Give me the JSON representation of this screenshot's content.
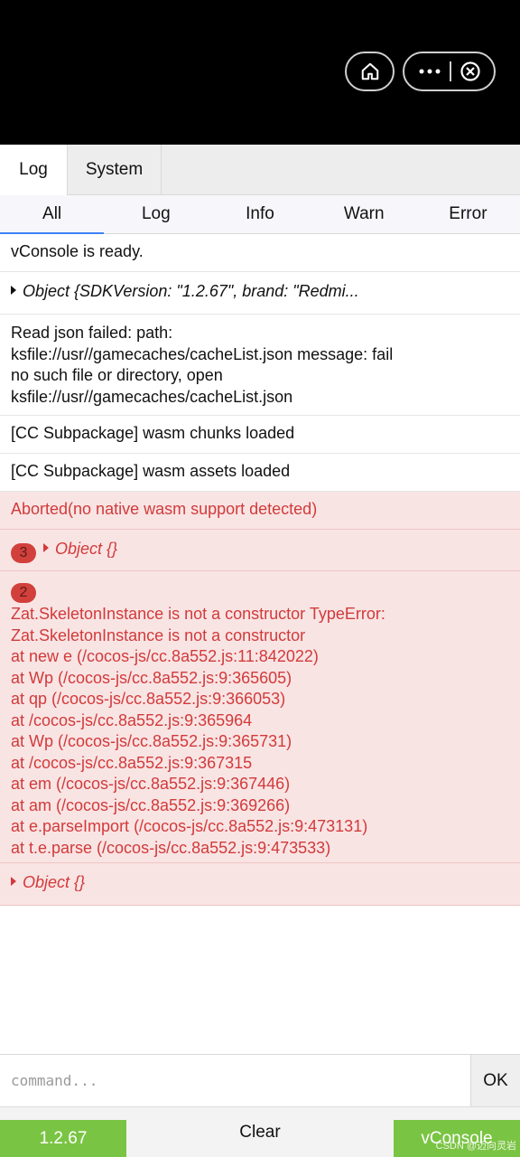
{
  "tabs": [
    "Log",
    "System"
  ],
  "filters": [
    "All",
    "Log",
    "Info",
    "Warn",
    "Error"
  ],
  "logs": {
    "ready": "vConsole is ready.",
    "object_sdk": "Object {SDKVersion: \"1.2.67\", brand: \"Redmi...",
    "read_json": [
      "Read json failed: path:",
      "ksfile://usr//gamecaches/cacheList.json message: fail",
      "no such file or directory, open",
      "ksfile://usr//gamecaches/cacheList.json"
    ],
    "wasm_chunks": "[CC Subpackage] wasm chunks loaded",
    "wasm_assets": "[CC Subpackage] wasm assets loaded",
    "aborted": "Aborted(no native wasm support detected)",
    "object_repeat_count": "3",
    "object_repeat": "Object {}",
    "error_repeat_count": "2",
    "error_lines": [
      "Zat.SkeletonInstance is not a constructor TypeError:",
      "Zat.SkeletonInstance is not a constructor",
      "at new e (/cocos-js/cc.8a552.js:11:842022)",
      "at Wp (/cocos-js/cc.8a552.js:9:365605)",
      "at qp (/cocos-js/cc.8a552.js:9:366053)",
      "at /cocos-js/cc.8a552.js:9:365964",
      "at Wp (/cocos-js/cc.8a552.js:9:365731)",
      "at /cocos-js/cc.8a552.js:9:367315",
      "at em (/cocos-js/cc.8a552.js:9:367446)",
      "at am (/cocos-js/cc.8a552.js:9:369266)",
      "at e.parseImport (/cocos-js/cc.8a552.js:9:473131)",
      "at t.e.parse (/cocos-js/cc.8a552.js:9:473533)"
    ],
    "object_last": "Object {}"
  },
  "command": {
    "placeholder": "command...",
    "ok_label": "OK"
  },
  "bottom": {
    "version": "1.2.67",
    "clear": "Clear",
    "vconsole": "vConsole"
  },
  "watermark": "CSDN @迈向灵岩",
  "colors": {
    "error_bg": "#f9e4e4",
    "error_text": "#d23a3a",
    "accent_green": "#7ac443",
    "active_tab_line": "#3e82f7"
  },
  "icons": [
    "home-icon",
    "more-dots-icon",
    "close-circle-icon",
    "expand-caret-icon"
  ]
}
